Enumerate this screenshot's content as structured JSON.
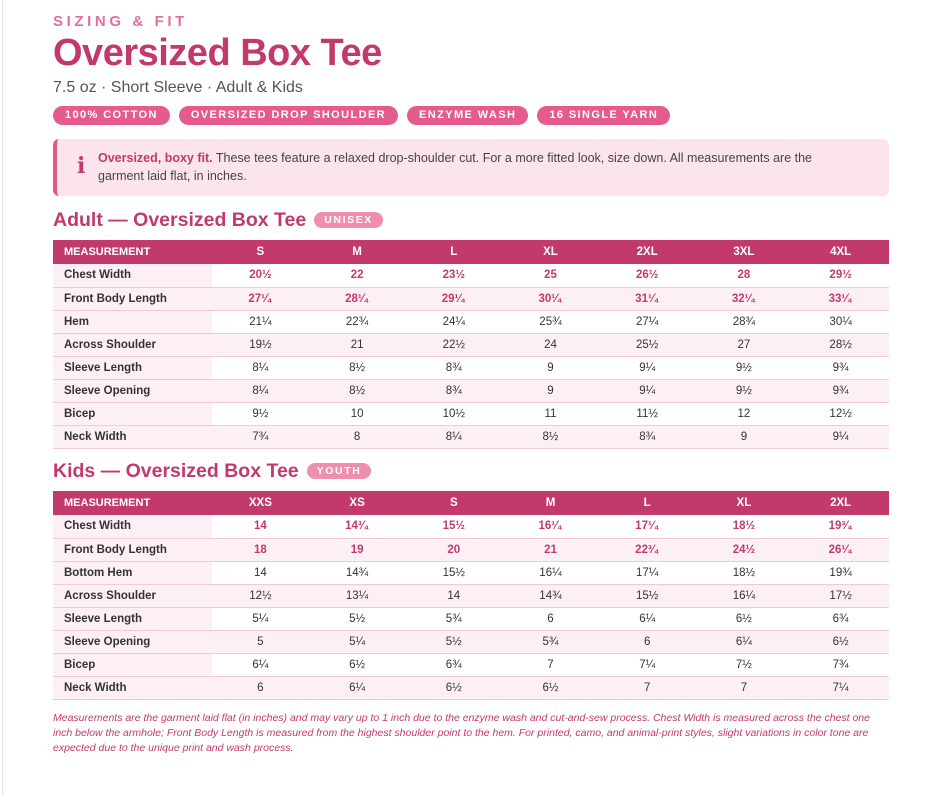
{
  "eyebrow": "SIZING & FIT",
  "title": "Oversized Box Tee",
  "subtitle": "7.5 oz · Short Sleeve · Adult & Kids",
  "tags": [
    "100% COTTON",
    "OVERSIZED DROP SHOULDER",
    "ENZYME WASH",
    "16 SINGLE YARN"
  ],
  "note": {
    "icon": "info-icon",
    "lead": "Oversized, boxy fit.",
    "text": " These tees feature a relaxed drop-shoulder cut. For a more fitted look, size down. All measurements are the garment laid flat, in inches."
  },
  "adult": {
    "title": "Adult — Oversized Box Tee",
    "badge": "UNISEX",
    "header": "MEASUREMENT",
    "sizes": [
      "S",
      "M",
      "L",
      "XL",
      "2XL",
      "3XL",
      "4XL"
    ],
    "rows": [
      {
        "label": "Chest Width",
        "values": [
          "20½",
          "22",
          "23½",
          "25",
          "26½",
          "28",
          "29½"
        ]
      },
      {
        "label": "Front Body Length",
        "values": [
          "27¹⁄₄",
          "28¹⁄₄",
          "29¹⁄₄",
          "30¹⁄₄",
          "31¹⁄₄",
          "32¹⁄₄",
          "33¹⁄₄"
        ]
      },
      {
        "label": "Hem",
        "values": [
          "21¼",
          "22¾",
          "24¼",
          "25¾",
          "27¼",
          "28¾",
          "30¼"
        ]
      },
      {
        "label": "Across Shoulder",
        "values": [
          "19½",
          "21",
          "22½",
          "24",
          "25½",
          "27",
          "28½"
        ]
      },
      {
        "label": "Sleeve Length",
        "values": [
          "8¼",
          "8½",
          "8¾",
          "9",
          "9¼",
          "9½",
          "9¾"
        ]
      },
      {
        "label": "Sleeve Opening",
        "values": [
          "8¼",
          "8½",
          "8¾",
          "9",
          "9¼",
          "9½",
          "9¾"
        ]
      },
      {
        "label": "Bicep",
        "values": [
          "9½",
          "10",
          "10½",
          "11",
          "11½",
          "12",
          "12½"
        ]
      },
      {
        "label": "Neck Width",
        "values": [
          "7¾",
          "8",
          "8¼",
          "8½",
          "8¾",
          "9",
          "9¼"
        ]
      }
    ]
  },
  "kids": {
    "title": "Kids — Oversized Box Tee",
    "badge": "YOUTH",
    "header": "MEASUREMENT",
    "sizes": [
      "XXS",
      "XS",
      "S",
      "M",
      "L",
      "XL",
      "2XL"
    ],
    "rows": [
      {
        "label": "Chest Width",
        "values": [
          "14",
          "14³⁄₄",
          "15½",
          "16¹⁄₄",
          "17¹⁄₄",
          "18½",
          "19³⁄₄"
        ]
      },
      {
        "label": "Front Body Length",
        "values": [
          "18",
          "19",
          "20",
          "21",
          "22³⁄₄",
          "24½",
          "26¹⁄₄"
        ]
      },
      {
        "label": "Bottom Hem",
        "values": [
          "14",
          "14¾",
          "15½",
          "16¼",
          "17¼",
          "18½",
          "19¾"
        ]
      },
      {
        "label": "Across Shoulder",
        "values": [
          "12½",
          "13¼",
          "14",
          "14¾",
          "15½",
          "16¼",
          "17½"
        ]
      },
      {
        "label": "Sleeve Length",
        "values": [
          "5¼",
          "5½",
          "5¾",
          "6",
          "6¼",
          "6½",
          "6¾"
        ]
      },
      {
        "label": "Sleeve Opening",
        "values": [
          "5",
          "5¼",
          "5½",
          "5¾",
          "6",
          "6¼",
          "6½"
        ]
      },
      {
        "label": "Bicep",
        "values": [
          "6¼",
          "6½",
          "6¾",
          "7",
          "7¼",
          "7½",
          "7¾"
        ]
      },
      {
        "label": "Neck Width",
        "values": [
          "6",
          "6¼",
          "6½",
          "6½",
          "7",
          "7",
          "7¼"
        ]
      }
    ]
  },
  "footnote": "Measurements are the garment laid flat (in inches) and may vary up to 1 inch due to the enzyme wash and cut-and-sew process. Chest Width is measured across the chest one inch below the armhole; Front Body Length is measured from the highest shoulder point to the hem. For printed, camo, and animal-print styles, slight variations in color tone are expected due to the unique print and wash process.",
  "colors": {
    "accent": "#c23a6c",
    "tag": "#e45b8c",
    "note_bg": "#fce4ec"
  }
}
